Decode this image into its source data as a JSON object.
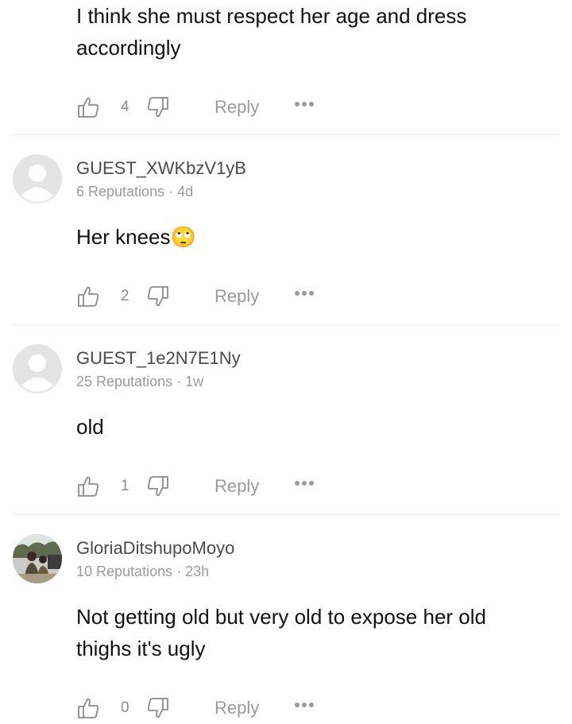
{
  "comments": [
    {
      "text": "I think she must respect her age and dress accordingly",
      "likes": "4",
      "reply_label": "Reply"
    },
    {
      "author": "GUEST_XWKbzV1yB",
      "reputations": "6 Reputations",
      "time": "4d",
      "text": "Her knees",
      "emoji": "🙄",
      "likes": "2",
      "reply_label": "Reply"
    },
    {
      "author": "GUEST_1e2N7E1Ny",
      "reputations": "25 Reputations",
      "time": "1w",
      "text": "old",
      "likes": "1",
      "reply_label": "Reply"
    },
    {
      "author": "GloriaDitshupoMoyo",
      "reputations": "10 Reputations",
      "time": "23h",
      "text": "Not getting old but very old to expose her old thighs it's ugly",
      "likes": "0",
      "reply_label": "Reply"
    }
  ],
  "meta_separator": " · ",
  "icons": {
    "like": "thumbs-up-outline",
    "dislike": "thumbs-down-outline",
    "more": "three-dots",
    "avatar_default": "default-user-avatar",
    "avatar_photo": "user-photo-avatar"
  },
  "colors": {
    "text": "#111111",
    "author": "#4a4a4a",
    "muted": "#9a9a9a",
    "icon": "#8a8a8a",
    "divider": "#e6e6e6",
    "avatar_bg": "#e4e4e4"
  }
}
